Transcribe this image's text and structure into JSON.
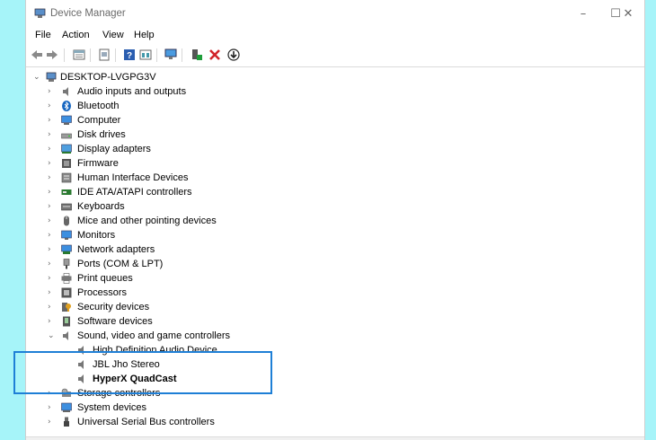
{
  "window": {
    "title": "Device Manager",
    "controls": {
      "minimize": "–",
      "maximize": "☐",
      "close": "✕"
    }
  },
  "menu": [
    "File",
    "Action",
    "View",
    "Help"
  ],
  "toolbar": {
    "buttons": [
      "back-icon",
      "forward-icon",
      "properties-icon",
      "update-driver-icon",
      "help-icon",
      "view-icon",
      "scan-hardware-icon",
      "add-driver-icon",
      "uninstall-icon",
      "download-icon"
    ]
  },
  "tree": {
    "root": "DESKTOP-LVGPG3V",
    "categories": [
      "Audio inputs and outputs",
      "Bluetooth",
      "Computer",
      "Disk drives",
      "Display adapters",
      "Firmware",
      "Human Interface Devices",
      "IDE ATA/ATAPI controllers",
      "Keyboards",
      "Mice and other pointing devices",
      "Monitors",
      "Network adapters",
      "Ports (COM & LPT)",
      "Print queues",
      "Processors",
      "Security devices",
      "Software devices",
      "Sound, video and game controllers",
      "Storage controllers",
      "System devices",
      "Universal Serial Bus controllers"
    ],
    "sound_children": [
      "High Definition Audio Device",
      "JBL Jho Stereo",
      "HyperX QuadCast"
    ]
  },
  "colors": {
    "highlight_box": "#1e7fd6",
    "background": "#a6f4f9"
  }
}
